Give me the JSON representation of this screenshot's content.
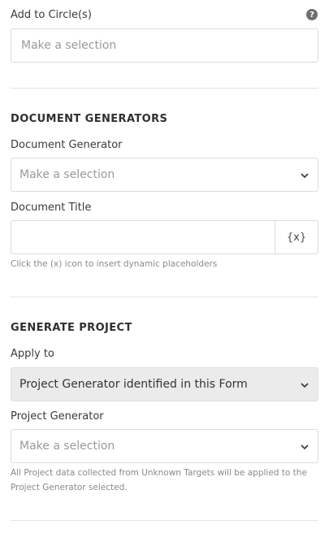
{
  "circles": {
    "label": "Add to Circle(s)",
    "help_glyph": "?",
    "placeholder": "Make a selection"
  },
  "document_generators": {
    "section_title": "DOCUMENT GENERATORS",
    "generator_label": "Document Generator",
    "generator_placeholder": "Make a selection",
    "title_label": "Document Title",
    "title_value": "",
    "placeholder_button": "{x}",
    "hint": "Click the (x) icon to insert dynamic placeholders"
  },
  "generate_project": {
    "section_title": "GENERATE PROJECT",
    "apply_label": "Apply to",
    "apply_value": "Project Generator identified in this Form",
    "generator_label": "Project Generator",
    "generator_placeholder": "Make a selection",
    "hint": "All Project data collected from Unknown Targets will be applied to the Project Generator selected."
  },
  "icons": {
    "help": "question-circle-icon",
    "chevron": "chevron-down-icon"
  },
  "colors": {
    "border": "#dcdcdc",
    "disabled_bg": "#ebebeb",
    "placeholder_text": "#9a9a9a"
  }
}
